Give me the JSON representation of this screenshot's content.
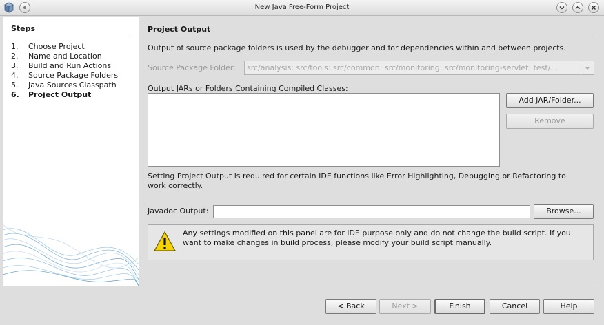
{
  "window": {
    "title": "New Java Free-Form Project",
    "icons": {
      "app": "java-cube-icon",
      "minimize": "chevron-down-icon",
      "maximize": "chevron-up-icon",
      "close": "close-icon"
    }
  },
  "steps": {
    "title": "Steps",
    "items": [
      {
        "num": "1.",
        "label": "Choose Project"
      },
      {
        "num": "2.",
        "label": "Name and Location"
      },
      {
        "num": "3.",
        "label": "Build and Run Actions"
      },
      {
        "num": "4.",
        "label": "Source Package Folders"
      },
      {
        "num": "5.",
        "label": "Java Sources Classpath"
      },
      {
        "num": "6.",
        "label": "Project Output"
      }
    ],
    "current_index": 5
  },
  "panel": {
    "title": "Project Output",
    "description": "Output of source package folders is used by the debugger and for dependencies within and between projects.",
    "source_folder_label": "Source Package Folder:",
    "source_folder_value": "src/analysis: src/tools: src/common: src/monitoring: src/monitoring-servlet: test/...",
    "output_label": "Output JARs or Folders Containing Compiled Classes:",
    "output_items": [],
    "add_button": "Add JAR/Folder...",
    "remove_button": "Remove",
    "note": "Setting Project Output is required for certain IDE functions like Error Highlighting, Debugging or Refactoring to work correctly.",
    "javadoc_label": "Javadoc Output:",
    "javadoc_value": "",
    "browse_button": "Browse...",
    "warning_icon": "warning-icon",
    "warning": "Any settings modified on this panel are for IDE purpose only and do not change the build script. If you want to make changes in build process, please modify your build script manually."
  },
  "footer": {
    "back": "< Back",
    "next": "Next >",
    "finish": "Finish",
    "cancel": "Cancel",
    "help": "Help"
  }
}
